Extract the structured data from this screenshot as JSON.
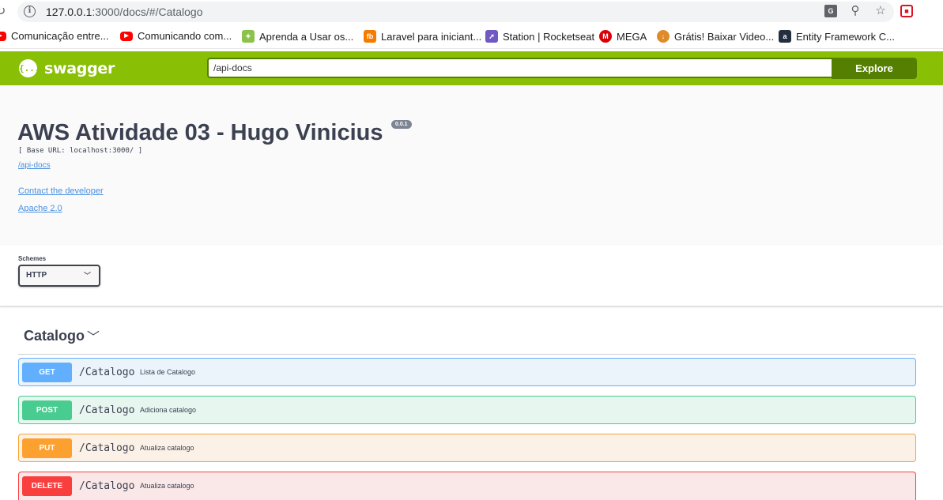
{
  "browser": {
    "url_host": "127.0.0.1",
    "url_path": ":3000/docs/#/Catalogo",
    "bookmarks": [
      {
        "label": "Comunicação entre...",
        "icon": "youtube-icon",
        "color": "#ff0000"
      },
      {
        "label": "Comunicando com...",
        "icon": "youtube-icon",
        "color": "#ff0000"
      },
      {
        "label": "Aprenda a Usar os...",
        "icon": "puzzle-icon",
        "color": "#8bc34a"
      },
      {
        "label": "Laravel para iniciant...",
        "icon": "fb-icon",
        "color": "#f57c00"
      },
      {
        "label": "Station | Rocketseat",
        "icon": "rocket-icon",
        "color": "#7159c1"
      },
      {
        "label": "MEGA",
        "icon": "mega-icon",
        "color": "#d90007"
      },
      {
        "label": "Grátis! Baixar Video...",
        "icon": "download-icon",
        "color": "#e08a2a"
      },
      {
        "label": "Entity Framework C...",
        "icon": "a-icon",
        "color": "#232f3e"
      }
    ]
  },
  "topbar": {
    "logo_text": "swagger",
    "logo_mark": "{...}",
    "api_url": "/api-docs",
    "explore_label": "Explore",
    "color": "#89bf04"
  },
  "info": {
    "title": "AWS Atividade 03 - Hugo Vinicius",
    "version": "0.0.1",
    "base_url": "[ Base URL: localhost:3000/ ]",
    "docs_link": "/api-docs",
    "contact_link": "Contact the developer",
    "license_link": "Apache 2.0"
  },
  "schemes": {
    "label": "Schemes",
    "selected": "HTTP"
  },
  "tag": {
    "name": "Catalogo",
    "operations": [
      {
        "method": "GET",
        "path": "/Catalogo",
        "summary": "Lista de Catalogo",
        "color": "#61affe",
        "bg": "#ebf3fb"
      },
      {
        "method": "POST",
        "path": "/Catalogo",
        "summary": "Adiciona catalogo",
        "color": "#49cc90",
        "bg": "#e8f6f0"
      },
      {
        "method": "PUT",
        "path": "/Catalogo",
        "summary": "Atualiza catalogo",
        "color": "#fca130",
        "bg": "#fbf1e6"
      },
      {
        "method": "DELETE",
        "path": "/Catalogo",
        "summary": "Atualiza catalogo",
        "color": "#f93e3e",
        "bg": "#fae7e7"
      }
    ]
  }
}
